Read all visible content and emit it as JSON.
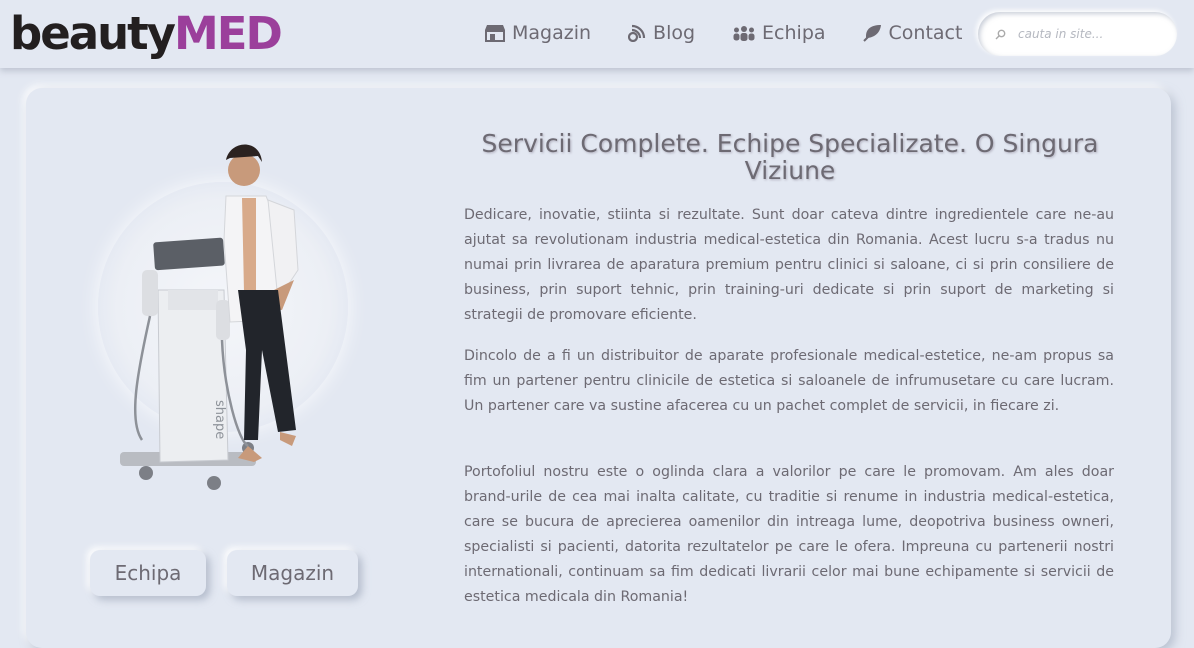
{
  "header": {
    "logo": {
      "part1": "beauty",
      "part2": "MED"
    },
    "nav": [
      {
        "label": "Magazin",
        "icon": "store-icon"
      },
      {
        "label": "Blog",
        "icon": "blog-icon"
      },
      {
        "label": "Echipa",
        "icon": "team-icon"
      },
      {
        "label": "Contact",
        "icon": "leaf-icon"
      }
    ],
    "search": {
      "placeholder": "cauta in site..."
    }
  },
  "main": {
    "title": "Servicii Complete. Echipe Specializate. O Singura Viziune",
    "paragraphs": [
      "Dedicare, inovatie, stiinta si rezultate. Sunt doar cateva dintre ingredientele care ne-au ajutat sa revolutionam industria medical-estetica din Romania. Acest lucru s-a tradus nu numai prin livrarea de aparatura premium pentru clinici si saloane, ci si prin consiliere de business, prin suport tehnic, prin training-uri dedicate si prin suport de marketing si strategii de promovare eficiente.",
      "Dincolo de a fi un distribuitor de aparate profesionale medical-estetice, ne-am propus sa fim un partener pentru clinicile de estetica si saloanele de infrumusetare cu care lucram. Un partener care va sustine afacerea cu un pachet complet de servicii, in fiecare zi.",
      "Portofoliul nostru este o oglinda clara a valorilor pe care le promovam. Am ales doar brand-urile de cea mai inalta calitate, cu traditie si renume in industria medical-estetica, care se bucura de aprecierea oamenilor din intreaga lume, deopotriva business owneri, specialisti si pacienti, datorita rezultatelor pe care le ofera. Impreuna cu partenerii nostri internationali, continuam sa fim dedicati livrarii celor mai bune echipamente si servicii de estetica medicala din Romania!"
    ],
    "buttons": {
      "echipa": "Echipa",
      "magazin": "Magazin"
    }
  },
  "colors": {
    "background": "#e3e8f2",
    "brand_dark": "#231f20",
    "brand_accent": "#9b3f9b",
    "text": "#6d6a73"
  }
}
